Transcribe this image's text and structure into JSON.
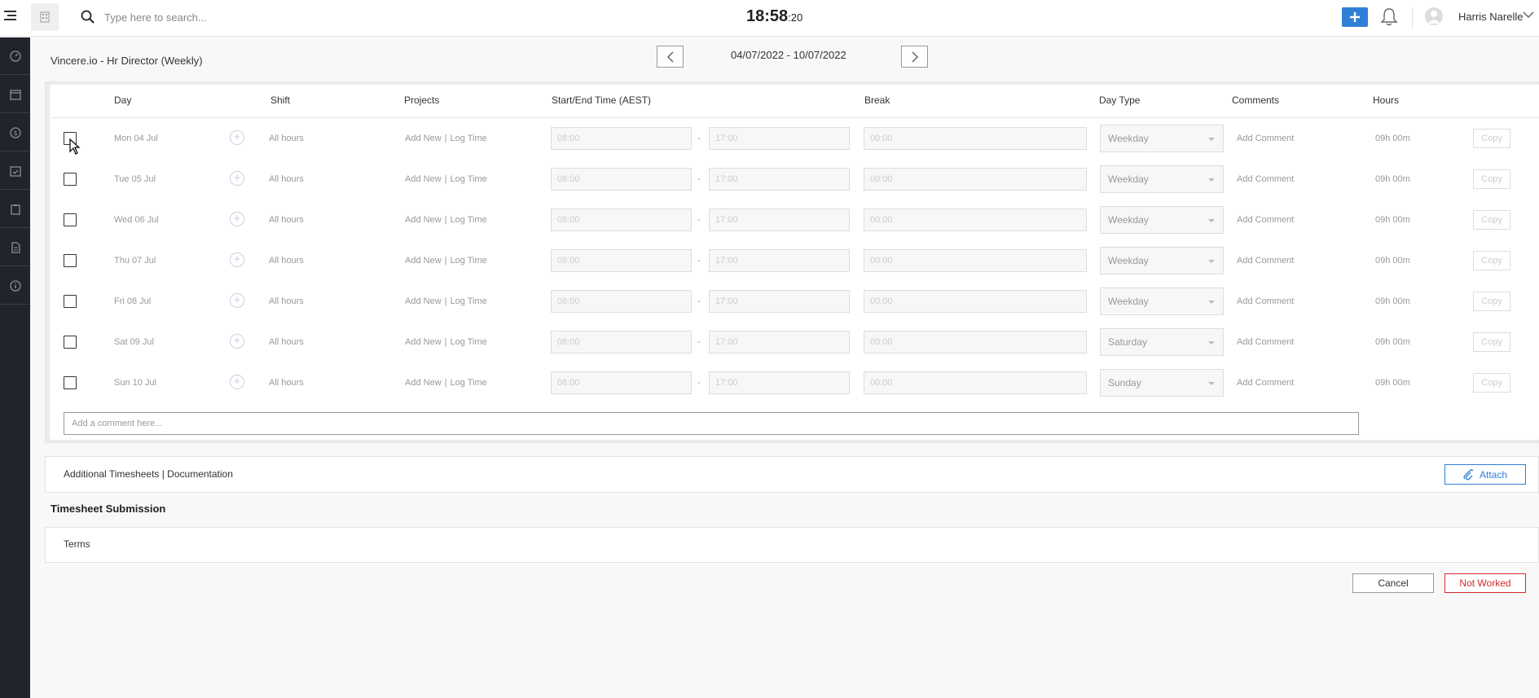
{
  "topbar": {
    "search_placeholder": "Type here to search...",
    "clock_main": "18:58",
    "clock_seconds": ":20",
    "user_name": "Harris Narelle"
  },
  "header": {
    "title": "Vincere.io - Hr Director (Weekly)",
    "date_range": "04/07/2022 - 10/07/2022"
  },
  "table": {
    "columns": {
      "day": "Day",
      "shift": "Shift",
      "projects": "Projects",
      "time": "Start/End Time (AEST)",
      "break": "Break",
      "day_type": "Day Type",
      "comments": "Comments",
      "hours": "Hours"
    },
    "rows": [
      {
        "day": "Mon 04 Jul",
        "shift": "All hours",
        "add_new": "Add New",
        "log_time": "Log Time",
        "start": "08:00",
        "end": "17:00",
        "break": "00:00",
        "day_type": "Weekday",
        "comment": "Add Comment",
        "hours": "09h 00m",
        "copy": "Copy"
      },
      {
        "day": "Tue 05 Jul",
        "shift": "All hours",
        "add_new": "Add New",
        "log_time": "Log Time",
        "start": "08:00",
        "end": "17:00",
        "break": "00:00",
        "day_type": "Weekday",
        "comment": "Add Comment",
        "hours": "09h 00m",
        "copy": "Copy"
      },
      {
        "day": "Wed 06 Jul",
        "shift": "All hours",
        "add_new": "Add New",
        "log_time": "Log Time",
        "start": "08:00",
        "end": "17:00",
        "break": "00:00",
        "day_type": "Weekday",
        "comment": "Add Comment",
        "hours": "09h 00m",
        "copy": "Copy"
      },
      {
        "day": "Thu 07 Jul",
        "shift": "All hours",
        "add_new": "Add New",
        "log_time": "Log Time",
        "start": "08:00",
        "end": "17:00",
        "break": "00:00",
        "day_type": "Weekday",
        "comment": "Add Comment",
        "hours": "09h 00m",
        "copy": "Copy"
      },
      {
        "day": "Fri 08 Jul",
        "shift": "All hours",
        "add_new": "Add New",
        "log_time": "Log Time",
        "start": "08:00",
        "end": "17:00",
        "break": "00:00",
        "day_type": "Weekday",
        "comment": "Add Comment",
        "hours": "09h 00m",
        "copy": "Copy"
      },
      {
        "day": "Sat 09 Jul",
        "shift": "All hours",
        "add_new": "Add New",
        "log_time": "Log Time",
        "start": "08:00",
        "end": "17:00",
        "break": "00:00",
        "day_type": "Saturday",
        "comment": "Add Comment",
        "hours": "09h 00m",
        "copy": "Copy"
      },
      {
        "day": "Sun 10 Jul",
        "shift": "All hours",
        "add_new": "Add New",
        "log_time": "Log Time",
        "start": "08:00",
        "end": "17:00",
        "break": "00:00",
        "day_type": "Sunday",
        "comment": "Add Comment",
        "hours": "09h 00m",
        "copy": "Copy"
      }
    ],
    "comment_placeholder": "Add a comment here..."
  },
  "additional": {
    "label": "Additional Timesheets | Documentation",
    "attach": "Attach"
  },
  "submission": {
    "title": "Timesheet Submission",
    "terms": "Terms"
  },
  "footer": {
    "cancel": "Cancel",
    "not_worked": "Not Worked"
  },
  "colors": {
    "accent": "#2f7fd6",
    "danger": "#d42a2a",
    "sidebar": "#20242b"
  }
}
